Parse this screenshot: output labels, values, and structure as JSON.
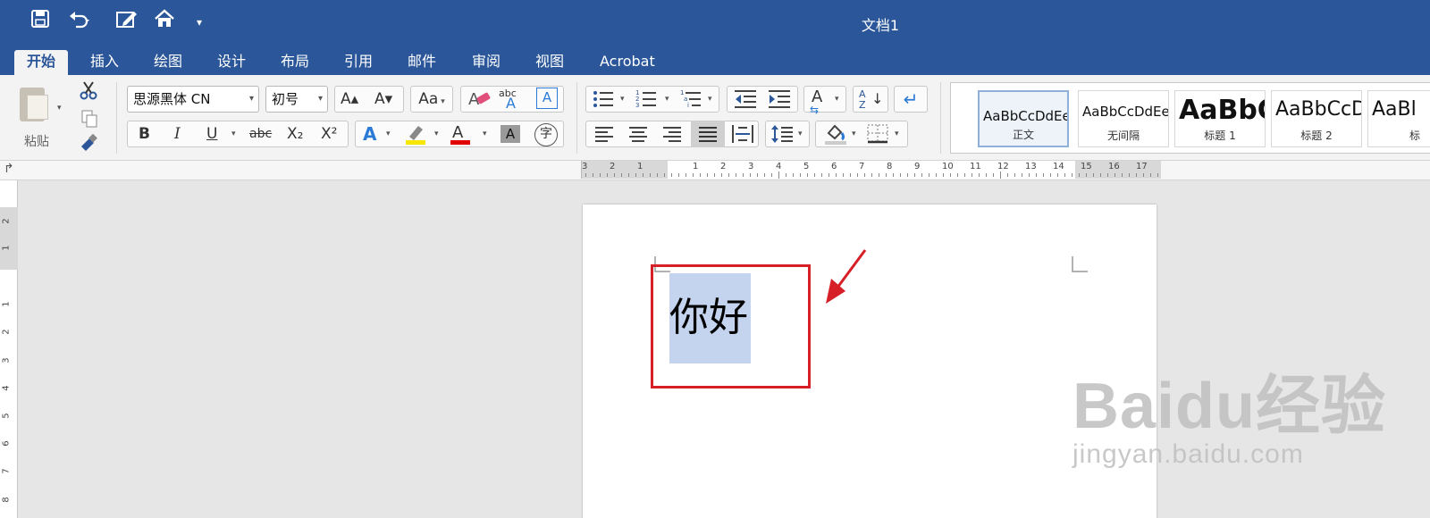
{
  "app": {
    "document_title": "文档1"
  },
  "colors": {
    "ribbon_blue": "#2b579a",
    "selection": "#c4d4ee",
    "annotation_red": "#d61f26"
  },
  "quick_access": [
    {
      "name": "save-icon",
      "glyph": "💾"
    },
    {
      "name": "undo-icon",
      "glyph": "↶"
    },
    {
      "name": "edit-doc-icon",
      "glyph": "✎"
    },
    {
      "name": "home-icon",
      "glyph": "⌂"
    },
    {
      "name": "customize-icon",
      "glyph": "▾"
    }
  ],
  "tabs": [
    "开始",
    "插入",
    "绘图",
    "设计",
    "布局",
    "引用",
    "邮件",
    "审阅",
    "视图",
    "Acrobat"
  ],
  "active_tab": "开始",
  "clipboard": {
    "paste_label": "粘贴"
  },
  "font": {
    "family": "思源黑体 CN",
    "size": "初号"
  },
  "format_buttons": {
    "grow": "A▴",
    "shrink": "A▾",
    "change_case": "Aa",
    "bold": "B",
    "italic": "I",
    "underline": "U",
    "strikethrough": "abc",
    "subscript": "X₂",
    "superscript": "X²",
    "abc_label": "abc"
  },
  "styles": [
    {
      "preview": "AaBbCcDdEe",
      "name": "正文"
    },
    {
      "preview": "AaBbCcDdEe",
      "name": "无间隔"
    },
    {
      "preview": "AaBbC",
      "name": "标题 1"
    },
    {
      "preview": "AaBbCcD",
      "name": "标题 2"
    },
    {
      "preview": "AaBl",
      "name": "标"
    }
  ],
  "ruler": {
    "numbers": [
      "3",
      "2",
      "1",
      "1",
      "2",
      "3",
      "4",
      "5",
      "6",
      "7",
      "8",
      "9",
      "10",
      "11",
      "12",
      "13",
      "14",
      "15",
      "16",
      "17"
    ]
  },
  "vruler": {
    "numbers": [
      "2",
      "1",
      "1",
      "2",
      "3",
      "4",
      "5",
      "6",
      "7",
      "8"
    ]
  },
  "document": {
    "text": "你好"
  },
  "watermark": {
    "brand": "Baidu经验",
    "url": "jingyan.baidu.com"
  }
}
